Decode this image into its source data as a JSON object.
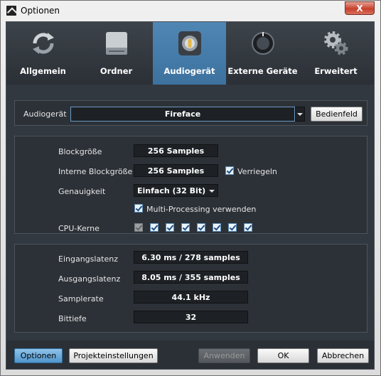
{
  "window": {
    "title": "Optionen",
    "close_glyph": "X"
  },
  "tabs": [
    {
      "label": "Allgemein",
      "icon": "refresh-icon"
    },
    {
      "label": "Ordner",
      "icon": "drive-icon"
    },
    {
      "label": "Audiogerät",
      "icon": "speaker-icon",
      "active": true
    },
    {
      "label": "Externe Geräte",
      "icon": "knob-icon"
    },
    {
      "label": "Erweitert",
      "icon": "gears-icon"
    }
  ],
  "device": {
    "label": "Audiogerät",
    "value": "Fireface",
    "button": "Bedienfeld"
  },
  "settings": {
    "block_size_label": "Blockgröße",
    "block_size_value": "256 Samples",
    "internal_block_label": "Interne Blockgröße",
    "internal_block_value": "256 Samples",
    "lock_label": "Verriegeln",
    "precision_label": "Genauigkeit",
    "precision_value": "Einfach (32 Bit)",
    "multiproc_label": "Multi-Processing verwenden",
    "cpu_label": "CPU-Kerne",
    "cpu_cores": [
      false,
      true,
      true,
      true,
      true,
      true,
      true,
      true
    ]
  },
  "info": {
    "in_latency_label": "Eingangslatenz",
    "in_latency_value": "6.30 ms / 278 samples",
    "out_latency_label": "Ausgangslatenz",
    "out_latency_value": "8.05 ms / 355 samples",
    "samplerate_label": "Samplerate",
    "samplerate_value": "44.1 kHz",
    "bitdepth_label": "Bittiefe",
    "bitdepth_value": "32"
  },
  "footer": {
    "options": "Optionen",
    "project": "Projekteinstellungen",
    "apply": "Anwenden",
    "ok": "OK",
    "cancel": "Abbrechen"
  }
}
